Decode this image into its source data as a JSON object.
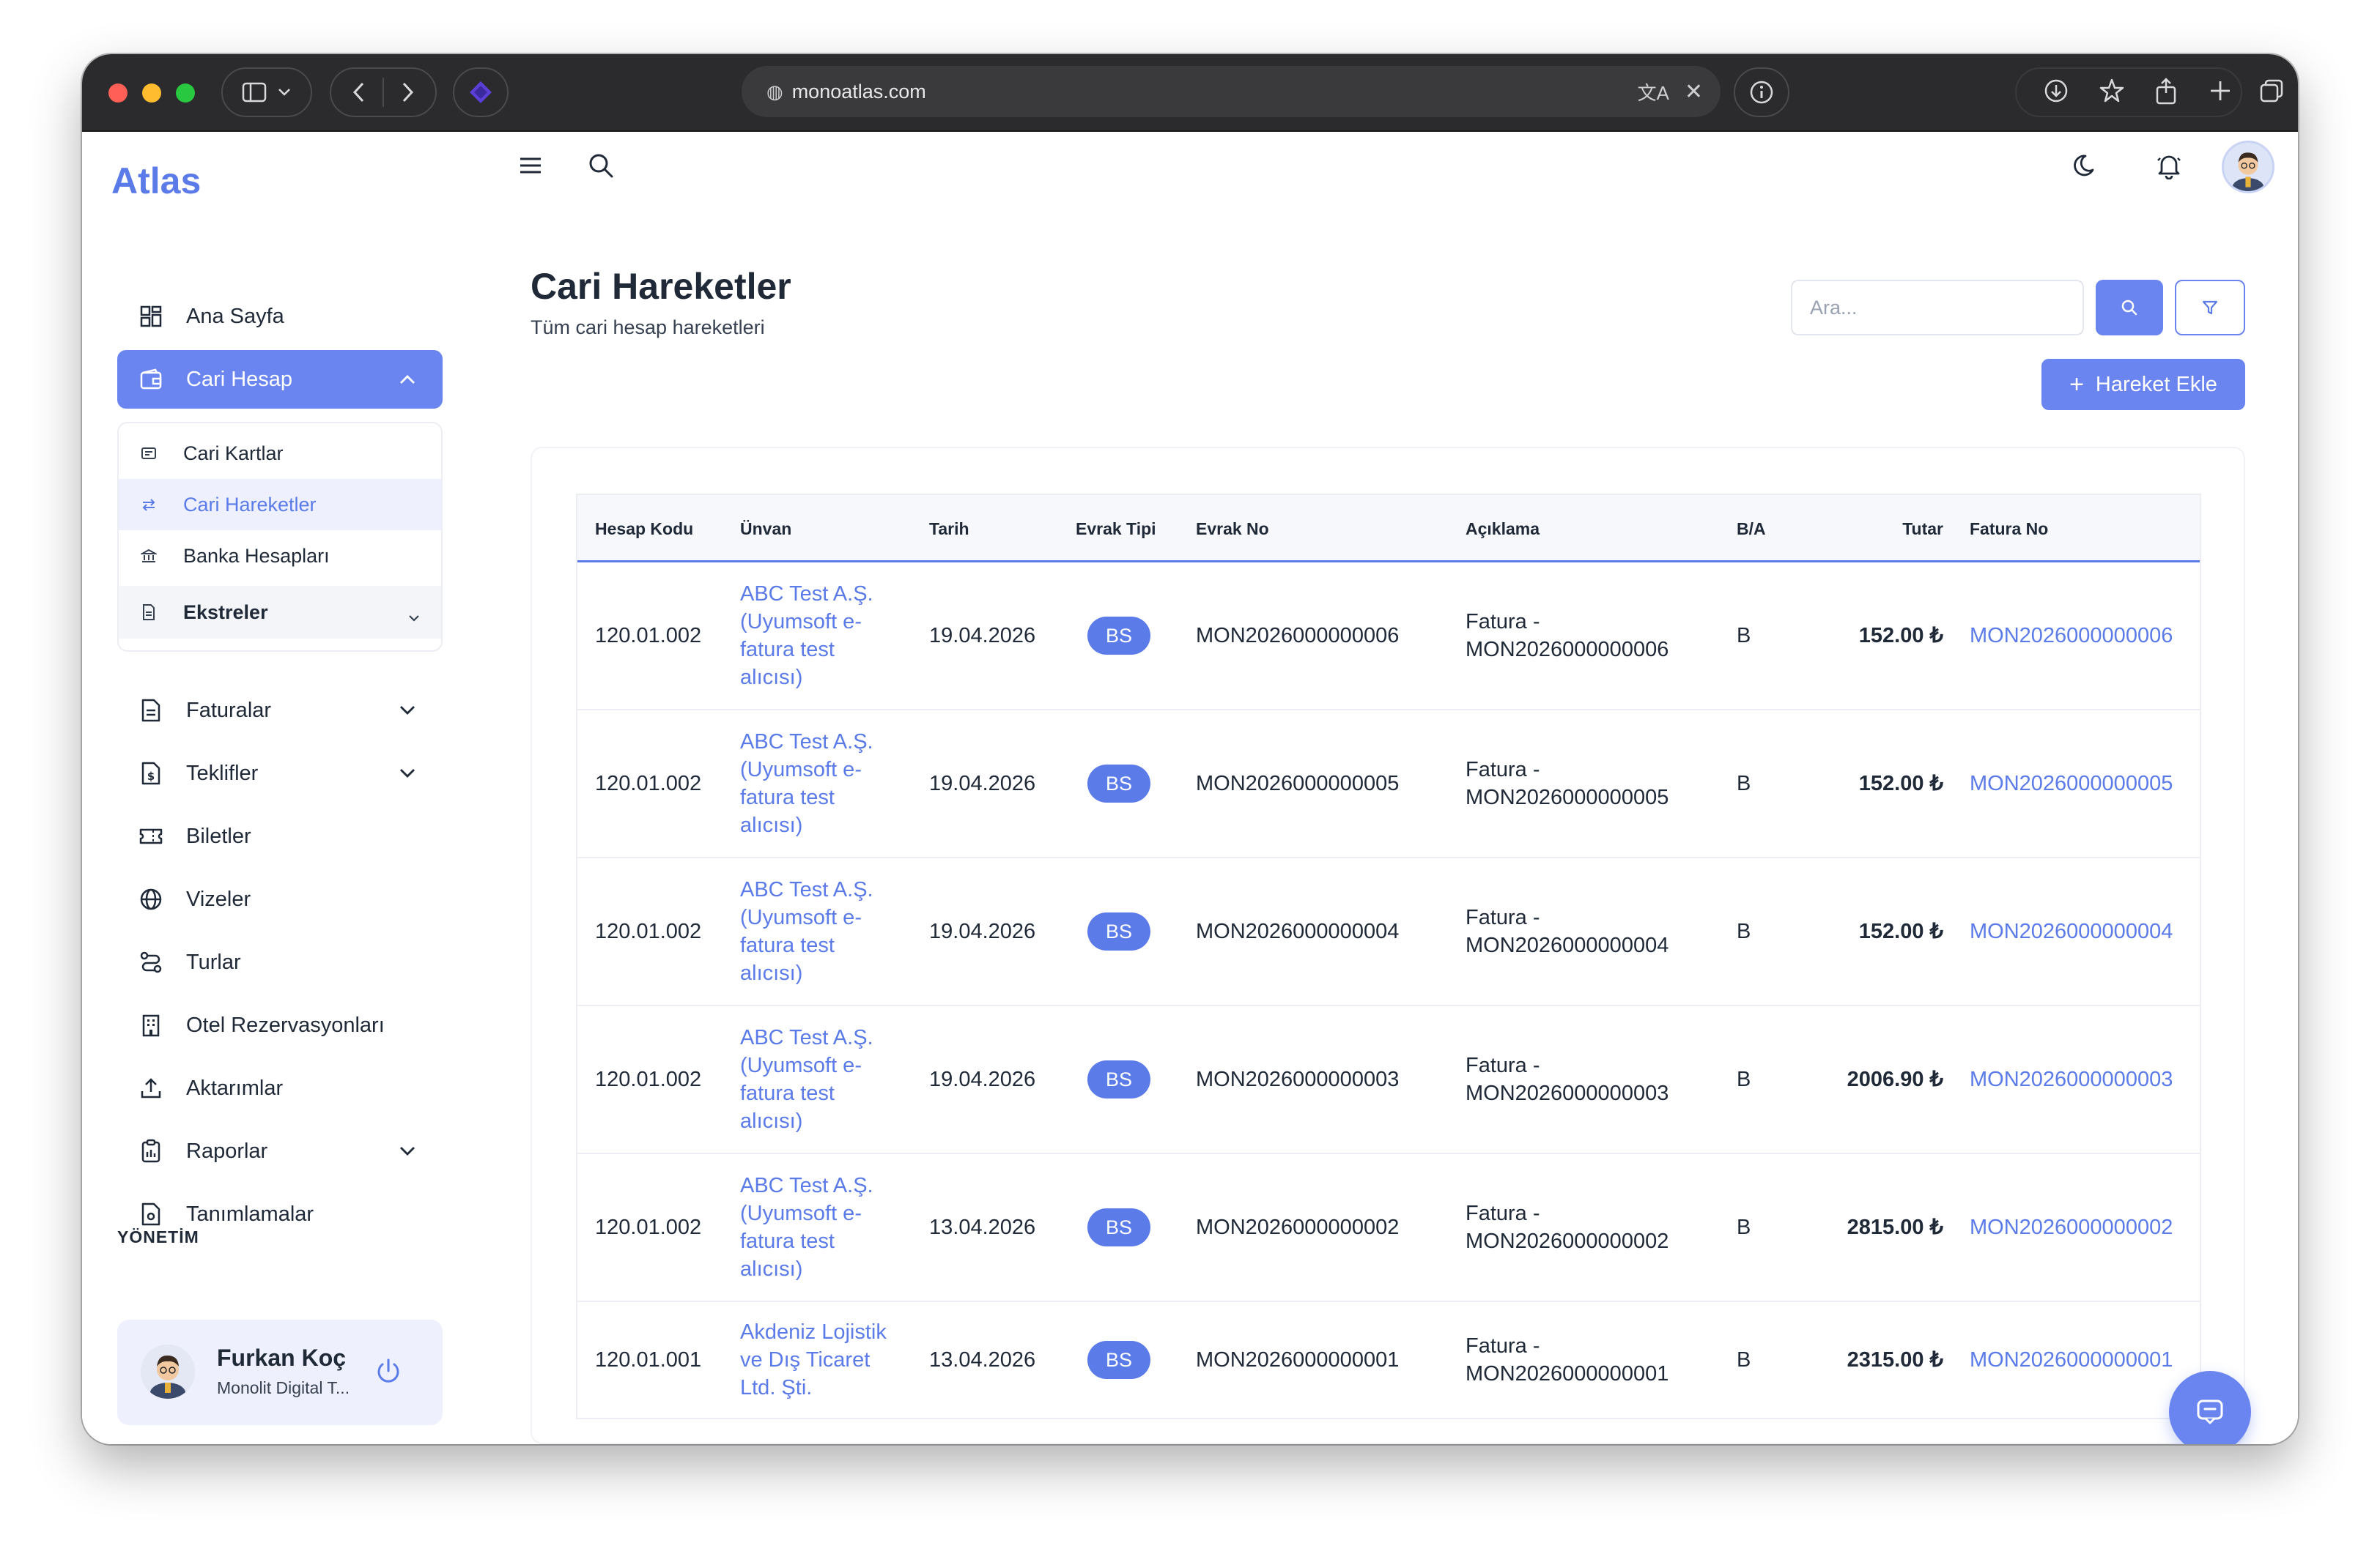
{
  "browser": {
    "url": "monoatlas.com"
  },
  "brand": "Atlas",
  "sidebar": {
    "items": [
      {
        "label": "Ana Sayfa",
        "icon": "grid-icon"
      },
      {
        "label": "Cari Hesap",
        "icon": "wallet-icon",
        "active": true
      },
      {
        "label": "Faturalar",
        "icon": "document-icon"
      },
      {
        "label": "Teklifler",
        "icon": "money-document-icon"
      },
      {
        "label": "Biletler",
        "icon": "ticket-icon"
      },
      {
        "label": "Vizeler",
        "icon": "globe-icon"
      },
      {
        "label": "Turlar",
        "icon": "route-icon"
      },
      {
        "label": "Otel Rezervasyonları",
        "icon": "building-icon"
      },
      {
        "label": "Aktarımlar",
        "icon": "upload-icon"
      },
      {
        "label": "Raporlar",
        "icon": "clipboard-icon"
      },
      {
        "label": "Tanımlamalar",
        "icon": "settings-document-icon"
      }
    ],
    "submenu": [
      {
        "label": "Cari Kartlar",
        "icon": "card-icon"
      },
      {
        "label": "Cari Hareketler",
        "icon": "swap-icon",
        "active": true
      },
      {
        "label": "Banka Hesapları",
        "icon": "bank-icon"
      },
      {
        "label": "Ekstreler",
        "icon": "file-icon"
      }
    ],
    "section_label": "YÖNETİM",
    "user": {
      "name": "Furkan Koç",
      "org": "Monolit Digital T..."
    }
  },
  "page": {
    "title": "Cari Hareketler",
    "subtitle": "Tüm cari hesap hareketleri",
    "search_placeholder": "Ara...",
    "add_button": "Hareket Ekle"
  },
  "table": {
    "headers": {
      "hesap_kodu": "Hesap Kodu",
      "unvan": "Ünvan",
      "tarih": "Tarih",
      "evrak_tipi": "Evrak Tipi",
      "evrak_no": "Evrak No",
      "aciklama": "Açıklama",
      "ba": "B/A",
      "tutar": "Tutar",
      "fatura_no": "Fatura No"
    },
    "rows": [
      {
        "hesap_kodu": "120.01.002",
        "unvan": "ABC Test A.Ş. (Uyumsoft e-fatura test alıcısı)",
        "tarih": "19.04.2026",
        "evrak_tipi": "BS",
        "evrak_no": "MON2026000000006",
        "aciklama": "Fatura - MON2026000000006",
        "ba": "B",
        "tutar": "152.00 ₺",
        "fatura_no": "MON2026000000006"
      },
      {
        "hesap_kodu": "120.01.002",
        "unvan": "ABC Test A.Ş. (Uyumsoft e-fatura test alıcısı)",
        "tarih": "19.04.2026",
        "evrak_tipi": "BS",
        "evrak_no": "MON2026000000005",
        "aciklama": "Fatura - MON2026000000005",
        "ba": "B",
        "tutar": "152.00 ₺",
        "fatura_no": "MON2026000000005"
      },
      {
        "hesap_kodu": "120.01.002",
        "unvan": "ABC Test A.Ş. (Uyumsoft e-fatura test alıcısı)",
        "tarih": "19.04.2026",
        "evrak_tipi": "BS",
        "evrak_no": "MON2026000000004",
        "aciklama": "Fatura - MON2026000000004",
        "ba": "B",
        "tutar": "152.00 ₺",
        "fatura_no": "MON2026000000004"
      },
      {
        "hesap_kodu": "120.01.002",
        "unvan": "ABC Test A.Ş. (Uyumsoft e-fatura test alıcısı)",
        "tarih": "19.04.2026",
        "evrak_tipi": "BS",
        "evrak_no": "MON2026000000003",
        "aciklama": "Fatura - MON2026000000003",
        "ba": "B",
        "tutar": "2006.90 ₺",
        "fatura_no": "MON2026000000003"
      },
      {
        "hesap_kodu": "120.01.002",
        "unvan": "ABC Test A.Ş. (Uyumsoft e-fatura test alıcısı)",
        "tarih": "13.04.2026",
        "evrak_tipi": "BS",
        "evrak_no": "MON2026000000002",
        "aciklama": "Fatura - MON2026000000002",
        "ba": "B",
        "tutar": "2815.00 ₺",
        "fatura_no": "MON2026000000002"
      },
      {
        "hesap_kodu": "120.01.001",
        "unvan": "Akdeniz Lojistik ve Dış Ticaret Ltd. Şti.",
        "tarih": "13.04.2026",
        "evrak_tipi": "BS",
        "evrak_no": "MON2026000000001",
        "aciklama": "Fatura - MON2026000000001",
        "ba": "B",
        "tutar": "2315.00 ₺",
        "fatura_no": "MON2026000000001"
      }
    ]
  },
  "colors": {
    "accent": "#6b85f0",
    "link": "#5b7be8",
    "text": "#1f2937"
  }
}
